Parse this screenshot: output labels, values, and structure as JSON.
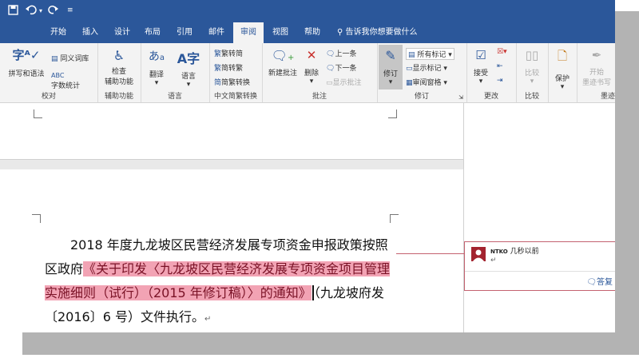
{
  "qat": {
    "save_icon": "save-icon",
    "undo_icon": "undo-icon",
    "redo_icon": "redo-icon",
    "customize_icon": "customize-qat-icon"
  },
  "tabs": [
    {
      "label": "开始"
    },
    {
      "label": "插入"
    },
    {
      "label": "设计"
    },
    {
      "label": "布局"
    },
    {
      "label": "引用"
    },
    {
      "label": "邮件"
    },
    {
      "label": "审阅"
    },
    {
      "label": "视图"
    },
    {
      "label": "帮助"
    }
  ],
  "search": {
    "text": "告诉我你想要做什么"
  },
  "ribbon": {
    "proofing": {
      "spelling": "拼写和语法",
      "thesaurus": "同义词库",
      "wordcount": "字数统计",
      "label": "校对"
    },
    "accessibility": {
      "check": "检查",
      "check2": "辅助功能",
      "label": "辅助功能"
    },
    "language": {
      "translate": "翻译",
      "language": "语言",
      "label": "语言"
    },
    "chinese": {
      "t2s": "繁转简",
      "s2t": "简转繁",
      "convert": "简繁转换",
      "label": "中文简繁转换"
    },
    "comments": {
      "new": "新建批注",
      "delete": "删除",
      "prev": "上一条",
      "next": "下一条",
      "show": "显示批注",
      "label": "批注"
    },
    "tracking": {
      "track": "修订",
      "markup": "所有标记",
      "show_markup": "显示标记",
      "pane": "审阅窗格",
      "label": "修订"
    },
    "changes": {
      "accept": "接受",
      "label": "更改"
    },
    "compare": {
      "compare": "比较",
      "label": "比较"
    },
    "protect": {
      "protect": "保护"
    },
    "ink": {
      "start": "开始",
      "start2": "墨迹书写",
      "label": "墨迹"
    }
  },
  "document": {
    "text_before": "2018 年度九龙坡区民营经济发展专项资金申报政策按照区政府",
    "inserted": "《关于印发〈九龙坡区民营经济发展专项资金项目管理实施细则（试行）（2015 年修订稿）〉的通知》",
    "text_after": "（九龙坡府发〔2016〕6 号）文件执行。",
    "para_mark": "↵"
  },
  "comment": {
    "author": "NTKO",
    "time": "几秒以前",
    "reply": "答复"
  }
}
